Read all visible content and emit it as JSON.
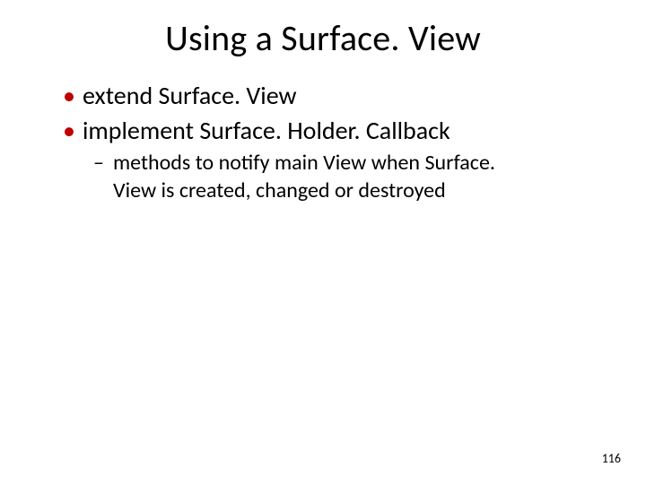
{
  "colors": {
    "bullet_accent": "#c00000"
  },
  "title": "Using a Surface. View",
  "bullets": [
    {
      "text": "extend Surface. View"
    },
    {
      "text": "implement Surface. Holder. Callback"
    }
  ],
  "sub_bullets": [
    {
      "text": "methods to notify main View when Surface. View is created, changed or destroyed"
    }
  ],
  "page_number": "116"
}
